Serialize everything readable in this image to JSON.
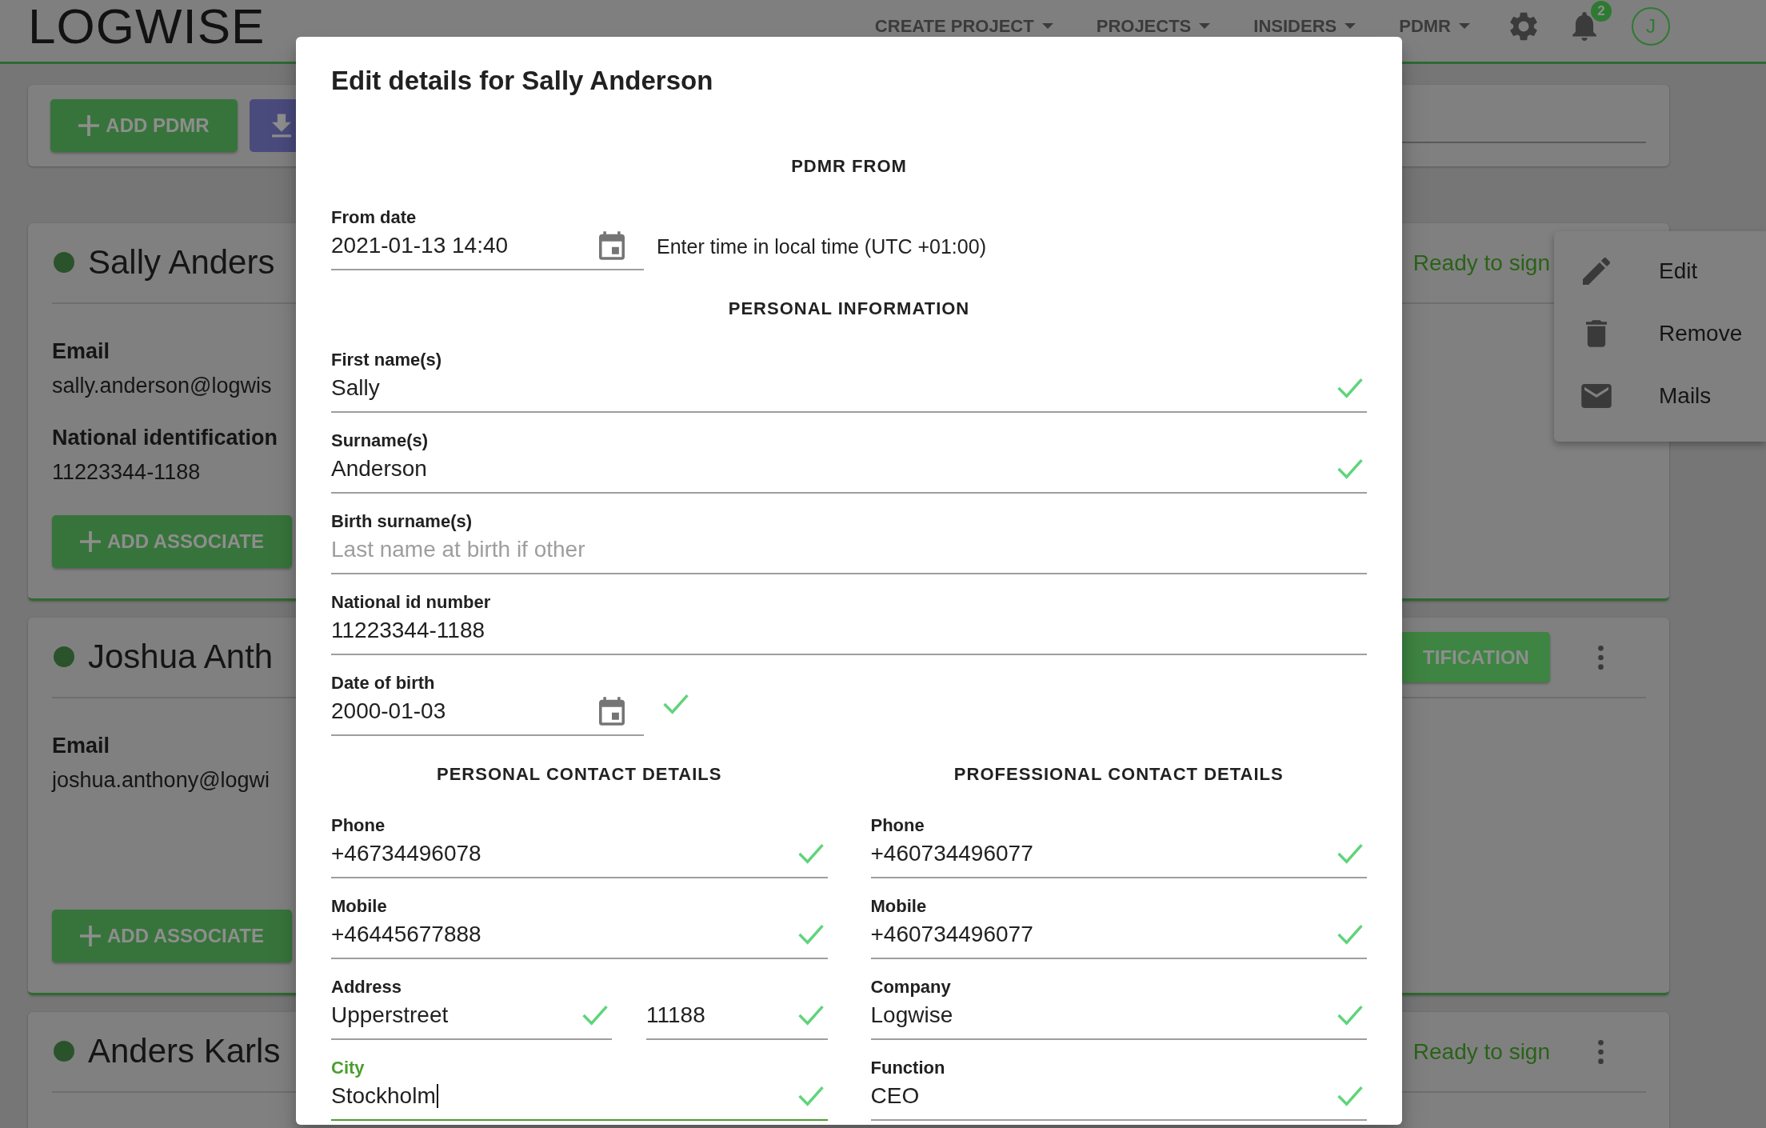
{
  "header": {
    "logo": "LOGWISE",
    "nav": [
      {
        "label": "CREATE PROJECT"
      },
      {
        "label": "PROJECTS"
      },
      {
        "label": "INSIDERS"
      },
      {
        "label": "PDMR"
      }
    ],
    "notifications": "2",
    "avatar": "J"
  },
  "toolbar": {
    "buttons": [
      {
        "kind": "add",
        "label": "ADD PDMR"
      },
      {
        "kind": "download"
      }
    ]
  },
  "cards": [
    {
      "name": "Sally Anders",
      "action": {
        "kind": "status",
        "label": "Ready to sign"
      },
      "menu": {
        "items": [
          {
            "kind": "edit",
            "label": "Edit"
          },
          {
            "kind": "remove",
            "label": "Remove"
          },
          {
            "kind": "mail",
            "label": "Mails"
          }
        ]
      },
      "details": [
        {
          "label": "Email",
          "value": "sally.anderson@logwis"
        },
        {
          "label": "National identification",
          "value": "11223344-1188"
        }
      ],
      "add_button": "ADD ASSOCIATE"
    },
    {
      "name": "Joshua Anth",
      "action": {
        "kind": "button",
        "label": "TIFICATION"
      },
      "details": [
        {
          "label": "Email",
          "value": "joshua.anthony@logwi"
        }
      ],
      "add_button": "ADD ASSOCIATE"
    },
    {
      "name": "Anders Karls",
      "action": {
        "kind": "status",
        "label": "Ready to sign"
      }
    }
  ],
  "dialog": {
    "title": "Edit details for Sally Anderson",
    "sections": [
      {
        "heading": "PDMR FROM",
        "fields": [
          {
            "kind": "date",
            "label": "From date",
            "value": "2021-01-13 14:40",
            "valid": false,
            "focused": false,
            "hint": "Enter time in local time (UTC +01:00)"
          }
        ]
      },
      {
        "heading": "PERSONAL INFORMATION",
        "fields": [
          {
            "kind": "text",
            "label": "First name(s)",
            "value": "Sally",
            "valid": true,
            "focused": false
          },
          {
            "kind": "text",
            "label": "Surname(s)",
            "value": "Anderson",
            "valid": true,
            "focused": false
          },
          {
            "kind": "text",
            "label": "Birth surname(s)",
            "placeholder": "Last name at birth if other",
            "valid": false,
            "focused": false
          },
          {
            "kind": "text",
            "label": "National id number",
            "value": "11223344-1188",
            "valid": false,
            "focused": false
          },
          {
            "kind": "date",
            "label": "Date of birth",
            "value": "2000-01-03",
            "valid": true,
            "focused": false
          }
        ]
      }
    ],
    "contact_columns": [
      {
        "heading": "PERSONAL CONTACT DETAILS",
        "fields": [
          {
            "kind": "text",
            "label": "Phone",
            "value": "+46734496078",
            "valid": true,
            "focused": false
          },
          {
            "kind": "text",
            "label": "Mobile",
            "value": "+46445677888",
            "valid": true,
            "focused": false
          },
          {
            "kind": "pair",
            "label": "Address",
            "focused": false,
            "parts": [
              {
                "value": "Upperstreet",
                "valid": true
              },
              {
                "value": "11188",
                "valid": true
              }
            ]
          },
          {
            "kind": "text",
            "label": "City",
            "value": "Stockholm",
            "valid": true,
            "focused": true
          }
        ]
      },
      {
        "heading": "PROFESSIONAL CONTACT DETAILS",
        "fields": [
          {
            "kind": "text",
            "label": "Phone",
            "value": "+460734496077",
            "valid": true,
            "focused": false
          },
          {
            "kind": "text",
            "label": "Mobile",
            "value": "+460734496077",
            "valid": true,
            "focused": false
          },
          {
            "kind": "text",
            "label": "Company",
            "value": "Logwise",
            "valid": true,
            "focused": false
          },
          {
            "kind": "text",
            "label": "Function",
            "value": "CEO",
            "valid": true,
            "focused": false
          }
        ]
      }
    ]
  }
}
